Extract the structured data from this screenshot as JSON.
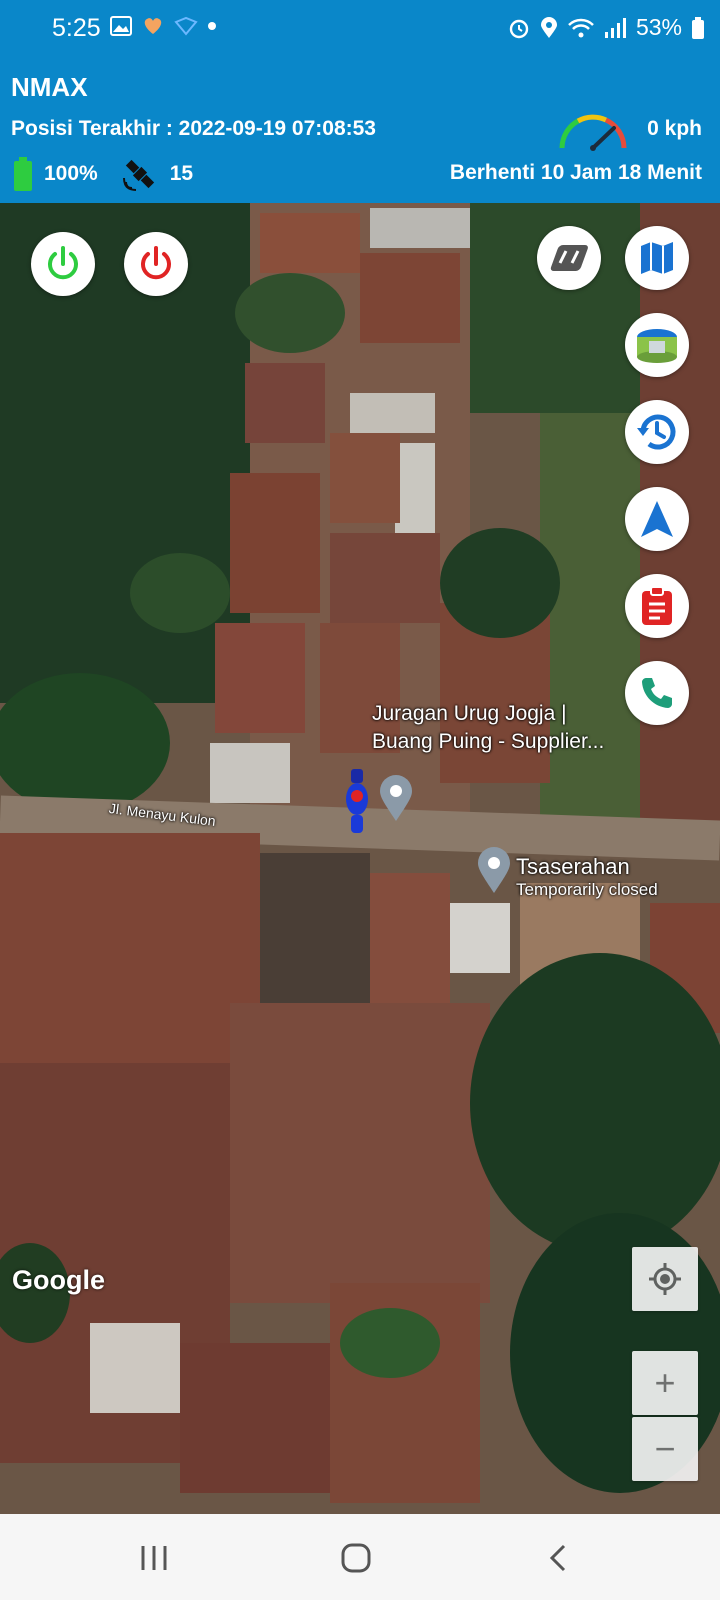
{
  "status_bar": {
    "time": "5:25",
    "battery": "53%"
  },
  "header": {
    "title": "NMAX",
    "last_position": "Posisi Terakhir : 2022-09-19 07:08:53",
    "speed": "0 kph",
    "battery": "100%",
    "satellites": "15",
    "stop_status": "Berhenti 10 Jam 18 Menit"
  },
  "map": {
    "street_label": "Jl. Menayu Kulon",
    "poi_1": {
      "line1": "Juragan Urug Jogja |",
      "line2": "Buang Puing - Supplier..."
    },
    "poi_2": {
      "name": "Tsaserahan",
      "status": "Temporarily closed"
    },
    "attribution": "Google"
  },
  "controls": {
    "zoom_in": "+",
    "zoom_out": "−"
  },
  "colors": {
    "header_bg": "#0a87c9",
    "engine_on": "#2ecc40",
    "engine_off": "#e02424",
    "action_blue": "#1a73d1"
  }
}
